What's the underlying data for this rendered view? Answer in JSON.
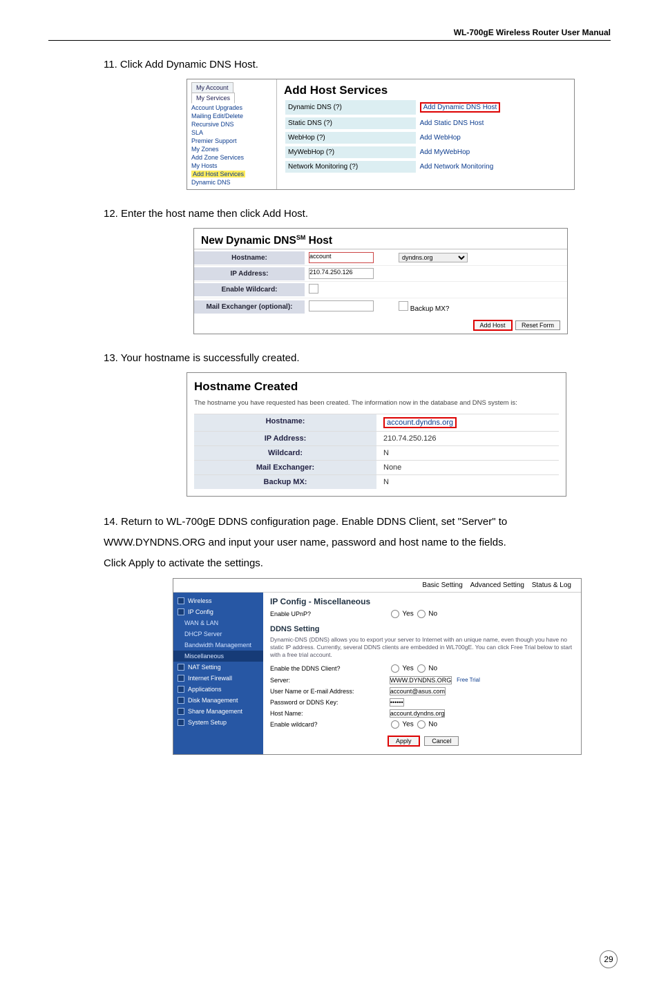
{
  "header": {
    "title": "WL-700gE Wireless Router User Manual"
  },
  "page_number": "29",
  "step11": {
    "text": "11. Click Add Dynamic DNS Host."
  },
  "ss1": {
    "tab1": "My Account",
    "tab2": "My Services",
    "left_links": [
      "Account Upgrades",
      "Mailing Edit/Delete",
      "Recursive DNS",
      "SLA",
      "Premier Support",
      "My Zones",
      "Add Zone Services",
      "My Hosts",
      "Add Host Services",
      "Dynamic DNS"
    ],
    "title": "Add Host Services",
    "rows": [
      {
        "left": "Dynamic DNS (?)",
        "right": "Add Dynamic DNS Host",
        "hl": true
      },
      {
        "left": "Static DNS (?)",
        "right": "Add Static DNS Host",
        "hl": false
      },
      {
        "left": "WebHop (?)",
        "right": "Add WebHop",
        "hl": false
      },
      {
        "left": "MyWebHop (?)",
        "right": "Add MyWebHop",
        "hl": false
      },
      {
        "left": "Network Monitoring (?)",
        "right": "Add Network Monitoring",
        "hl": false
      }
    ]
  },
  "step12": {
    "text": "12. Enter the host name then click Add Host."
  },
  "ss2": {
    "title_pre": "New Dynamic DNS",
    "title_sup": "SM",
    "title_post": " Host",
    "rows": [
      {
        "label": "Hostname:",
        "value": "account",
        "sel": "dyndns.org"
      },
      {
        "label": "IP Address:",
        "value": "210.74.250.126"
      },
      {
        "label": "Enable Wildcard:"
      },
      {
        "label": "Mail Exchanger (optional):",
        "value2": "Backup MX?"
      }
    ],
    "btn1": "Add Host",
    "btn2": "Reset Form"
  },
  "step13": {
    "text": "13. Your hostname is successfully created."
  },
  "ss3": {
    "heading": "Hostname Created",
    "desc": "The hostname you have requested has been created. The information now in the database and DNS system is:",
    "rows": [
      {
        "label": "Hostname:",
        "value": "account.dyndns.org",
        "red": true
      },
      {
        "label": "IP Address:",
        "value": "210.74.250.126"
      },
      {
        "label": "Wildcard:",
        "value": "N"
      },
      {
        "label": "Mail Exchanger:",
        "value": "None"
      },
      {
        "label": "Backup MX:",
        "value": "N"
      }
    ]
  },
  "step14": {
    "p1": "14. Return to WL-700gE DDNS configuration page. Enable DDNS Client, set \"Server\" to",
    "p2": "WWW.DYNDNS.ORG and input your user name, password and host name to the fields.",
    "p3": "Click Apply to activate the settings."
  },
  "ss4": {
    "top_tabs": [
      "Basic Setting",
      "Advanced Setting",
      "Status & Log"
    ],
    "nav": [
      "Wireless",
      "IP Config",
      "WAN & LAN",
      "DHCP Server",
      "Bandwidth Management",
      "Miscellaneous",
      "NAT Setting",
      "Internet Firewall",
      "Applications",
      "Disk Management",
      "Share Management",
      "System Setup"
    ],
    "heading": "IP Config - Miscellaneous",
    "r_upnp": "Enable UPnP?",
    "yn_yes": "Yes",
    "yn_no": "No",
    "sub_heading": "DDNS Setting",
    "desc": "Dynamic-DNS (DDNS) allows you to export your server to Internet with an unique name, even though you have no static IP address. Currently, several DDNS clients are embedded in WL700gE. You can click Free Trial below to start with a free trial account.",
    "r_enable": "Enable the DDNS Client?",
    "r_server": "Server:",
    "server_val": "WWW.DYNDNS.ORG",
    "free_trial": "Free Trial",
    "r_user": "User Name or E-mail Address:",
    "user_val": "account@asus.com",
    "r_pw": "Password or DDNS Key:",
    "pw_val": "••••••",
    "r_host": "Host Name:",
    "host_val": "account.dyndns.org",
    "r_wild": "Enable wildcard?",
    "btn_apply": "Apply",
    "btn_cancel": "Cancel"
  }
}
